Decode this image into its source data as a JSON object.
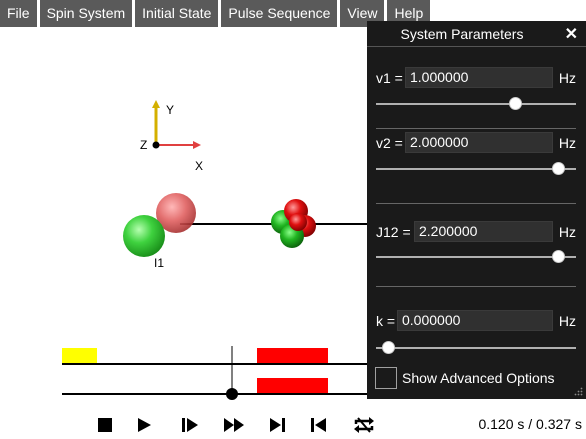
{
  "menu": {
    "items": [
      {
        "label": "File",
        "name": "menu-file"
      },
      {
        "label": "Spin System",
        "name": "menu-spin-system"
      },
      {
        "label": "Initial State",
        "name": "menu-initial-state"
      },
      {
        "label": "Pulse Sequence",
        "name": "menu-pulse-sequence"
      },
      {
        "label": "View",
        "name": "menu-view"
      },
      {
        "label": "Help",
        "name": "menu-help"
      }
    ]
  },
  "axes": {
    "x": "X",
    "y": "Y",
    "z": "Z"
  },
  "spin_label": "I1",
  "panel": {
    "title": "System Parameters",
    "close_icon": "close-icon",
    "params": [
      {
        "label": "v1 =",
        "value": "1.000000",
        "unit": "Hz",
        "slider_fraction": 0.71
      },
      {
        "label": "v2 =",
        "value": "2.000000",
        "unit": "Hz",
        "slider_fraction": 0.94
      },
      {
        "label": "J12 =",
        "value": "2.200000",
        "unit": "Hz",
        "slider_fraction": 0.94
      },
      {
        "label": "k =",
        "value": "0.000000",
        "unit": "Hz",
        "slider_fraction": 0.03
      }
    ],
    "advanced_label": "Show Advanced Options",
    "advanced_checked": false
  },
  "transport": {
    "buttons": [
      "stop-icon",
      "play-icon",
      "step-forward-icon",
      "fast-forward-icon",
      "skip-to-end-icon",
      "skip-to-start-icon",
      "loop-icon"
    ]
  },
  "time_readout": "0.120 s / 0.327 s",
  "colors": {
    "menu_bg": "#5a5a5a",
    "panel_bg": "#1a1a1a",
    "pulse_red": "#ff0000",
    "pulse_yellow": "#ffff00",
    "sphere_green": "#33cc33",
    "sphere_red": "#e04040"
  }
}
